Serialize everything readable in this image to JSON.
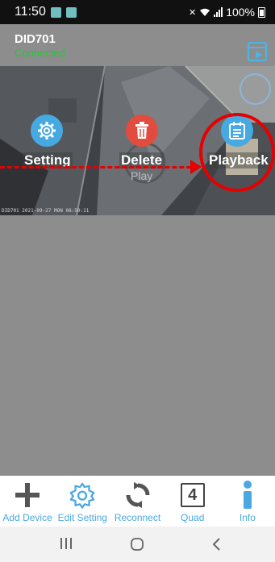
{
  "status_bar": {
    "time": "11:50",
    "battery": "100%"
  },
  "device": {
    "name": "DID701",
    "status": "Connected",
    "timestamp": "DID701  2021-09-27 MON 08:50:11"
  },
  "overlay": {
    "play_label": "Play"
  },
  "actions": [
    {
      "label": "Setting",
      "icon": "gear-icon",
      "color": "#47a9e2"
    },
    {
      "label": "Delete",
      "icon": "trash-icon",
      "color": "#e24c3f"
    },
    {
      "label": "Playback",
      "icon": "calendar-icon",
      "color": "#47a9e2"
    }
  ],
  "toolbar": [
    {
      "label": "Add Device",
      "icon": "plus-icon"
    },
    {
      "label": "Edit Setting",
      "icon": "gear-icon"
    },
    {
      "label": "Reconnect",
      "icon": "refresh-icon"
    },
    {
      "label": "Quad",
      "icon": "quad-icon",
      "badge": "4"
    },
    {
      "label": "Info",
      "icon": "info-icon"
    }
  ],
  "colors": {
    "accent": "#4aa8e0",
    "connected": "#29c33d",
    "annotation": "#e60000"
  }
}
